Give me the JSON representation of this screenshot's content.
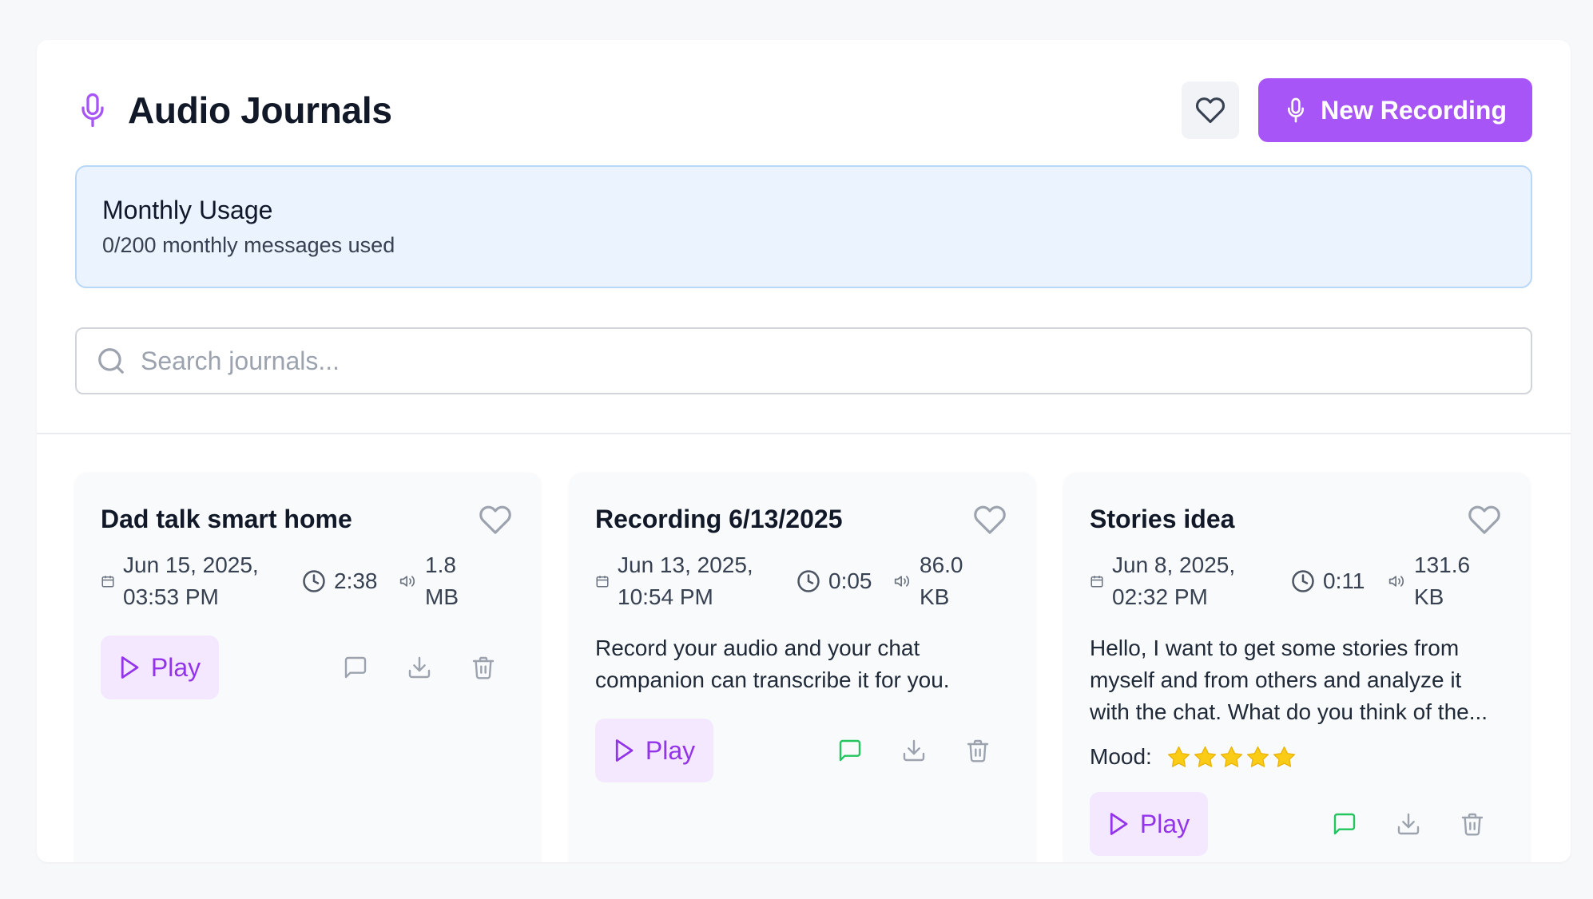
{
  "header": {
    "title": "Audio Journals",
    "new_button_label": "New Recording"
  },
  "usage": {
    "title": "Monthly Usage",
    "subtitle": "0/200 monthly messages used"
  },
  "search": {
    "placeholder": "Search journals..."
  },
  "cards": [
    {
      "title": "Dad talk smart home",
      "date_line1": "Jun 15, 2025,",
      "date_line2": "03:53 PM",
      "duration": "2:38",
      "size_line1": "1.8",
      "size_line2": "MB",
      "description": "",
      "play_label": "Play",
      "chat_active": false
    },
    {
      "title": "Recording 6/13/2025",
      "date_line1": "Jun 13, 2025,",
      "date_line2": "10:54 PM",
      "duration": "0:05",
      "size_line1": "86.0",
      "size_line2": "KB",
      "description": "Record your audio and your chat companion can transcribe it for you.",
      "play_label": "Play",
      "chat_active": true
    },
    {
      "title": "Stories idea",
      "date_line1": "Jun 8, 2025,",
      "date_line2": "02:32 PM",
      "duration": "0:11",
      "size_line1": "131.6",
      "size_line2": "KB",
      "description": "Hello, I want to get some stories from myself and from others and analyze it with the chat. What do you think of the...",
      "mood_label": "Mood:",
      "mood_stars": 5,
      "play_label": "Play",
      "chat_active": true
    }
  ],
  "colors": {
    "accent": "#a855f7",
    "play_bg": "#f3e8ff",
    "chat_active": "#22c55e",
    "icon_gray": "#9ca3af",
    "star": "#facc15"
  }
}
